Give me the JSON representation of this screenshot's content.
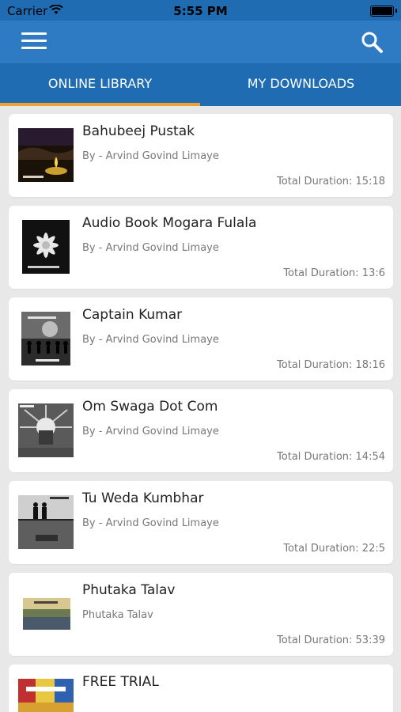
{
  "status_bar": {
    "carrier": "Carrier",
    "time": "5:55 PM"
  },
  "app_bar": {
    "menu_icon": "hamburger-menu-icon",
    "search_icon": "search-icon"
  },
  "tabs": [
    {
      "label": "ONLINE LIBRARY",
      "selected": true
    },
    {
      "label": "MY DOWNLOADS",
      "selected": false
    }
  ],
  "colors": {
    "status_bar": "#1f6cb2",
    "app_bar": "#2e7ac3",
    "tab_bar": "#1f6cb2",
    "tab_indicator": "#f0a030",
    "background": "#e8e8e8"
  },
  "books": [
    {
      "title": "Bahubeej Pustak",
      "author": "By - Arvind Govind Limaye",
      "duration": "Total Duration: 15:18"
    },
    {
      "title": "Audio Book Mogara Fulala",
      "author": "By - Arvind Govind Limaye",
      "duration": "Total Duration: 13:6"
    },
    {
      "title": "Captain Kumar",
      "author": "By - Arvind Govind Limaye",
      "duration": "Total Duration: 18:16"
    },
    {
      "title": "Om Swaga Dot Com",
      "author": " By - Arvind Govind Limaye",
      "duration": "Total Duration: 14:54"
    },
    {
      "title": "Tu Weda Kumbhar",
      "author": "By - Arvind Govind Limaye",
      "duration": "Total Duration: 22:5"
    },
    {
      "title": "Phutaka Talav",
      "author": "Phutaka Talav",
      "duration": "Total Duration: 53:39"
    },
    {
      "title": "FREE TRIAL",
      "author": "",
      "duration": ""
    }
  ]
}
